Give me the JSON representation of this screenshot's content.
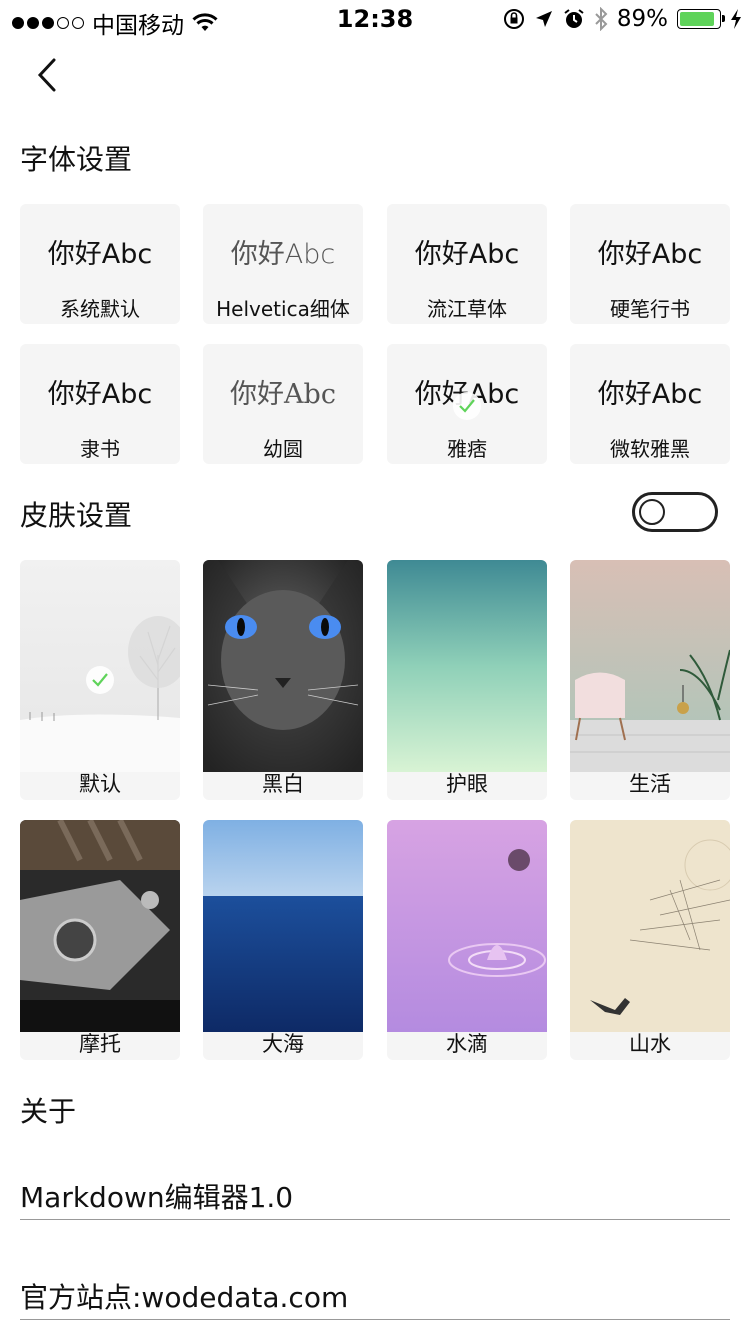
{
  "status_bar": {
    "carrier": "中国移动",
    "time": "12:38",
    "battery": "89%",
    "battery_level": 0.89,
    "signal_bars_filled": 3,
    "signal_bars_total": 5,
    "icons": [
      "wifi-icon",
      "orientation-lock-icon",
      "location-icon",
      "alarm-icon",
      "bluetooth-icon",
      "battery-icon",
      "charging-icon"
    ]
  },
  "nav": {
    "back_icon": "chevron-left-icon"
  },
  "font_section": {
    "title": "字体设置",
    "sample": "你好Abc",
    "fonts": [
      {
        "name": "系统默认"
      },
      {
        "name": "Helvetica细体"
      },
      {
        "name": "流江草体"
      },
      {
        "name": "硬笔行书"
      },
      {
        "name": "隶书"
      },
      {
        "name": "幼圆"
      },
      {
        "name": "雅痞"
      },
      {
        "name": "微软雅黑"
      }
    ],
    "selected": "雅痞"
  },
  "skin_section": {
    "title": "皮肤设置",
    "toggle_on": false,
    "skins": [
      {
        "name": "默认"
      },
      {
        "name": "黑白"
      },
      {
        "name": "护眼"
      },
      {
        "name": "生活"
      },
      {
        "name": "摩托"
      },
      {
        "name": "大海"
      },
      {
        "name": "水滴"
      },
      {
        "name": "山水"
      }
    ],
    "selected": "默认"
  },
  "about_section": {
    "title": "关于",
    "version": "Markdown编辑器1.0",
    "site": "官方站点:wodedata.com"
  },
  "colors": {
    "check": "#5fd35a",
    "tile_bg": "#f5f5f5"
  }
}
